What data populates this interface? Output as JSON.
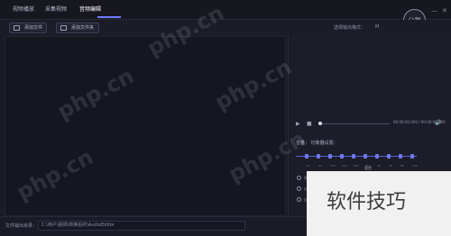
{
  "tabs": [
    {
      "label": "视频播放"
    },
    {
      "label": "采集视频"
    },
    {
      "label": "音频编辑"
    }
  ],
  "logo": {
    "text": "分割"
  },
  "window": {
    "minimize": "—",
    "close": "✕"
  },
  "toolbar": {
    "btn1": "添加文件",
    "btn2": "添加文件夹",
    "output_label": "选择输出格式：",
    "output_value": "M"
  },
  "player": {
    "play": "▶",
    "stop": "■",
    "time": "00:00:00.000 / 00:00:00.000",
    "volume": "🔊"
  },
  "right": {
    "section_title": "音量：  均衡器设置：",
    "reset": "重置",
    "options": [
      "原",
      "自",
      "自"
    ]
  },
  "equalizer": {
    "bands": [
      "31",
      "62",
      "125",
      "250",
      "500",
      "1K",
      "2K",
      "4K",
      "8K",
      "16K"
    ]
  },
  "status": {
    "label": "文件输出目录：",
    "path": "C:\\用户\\视频\\转换后的\\AudioEditor"
  },
  "watermarks": [
    "php.cn",
    "php.cn",
    "php.cn",
    "php.cn",
    "php.cn"
  ],
  "banner": {
    "text": "软件技巧"
  }
}
